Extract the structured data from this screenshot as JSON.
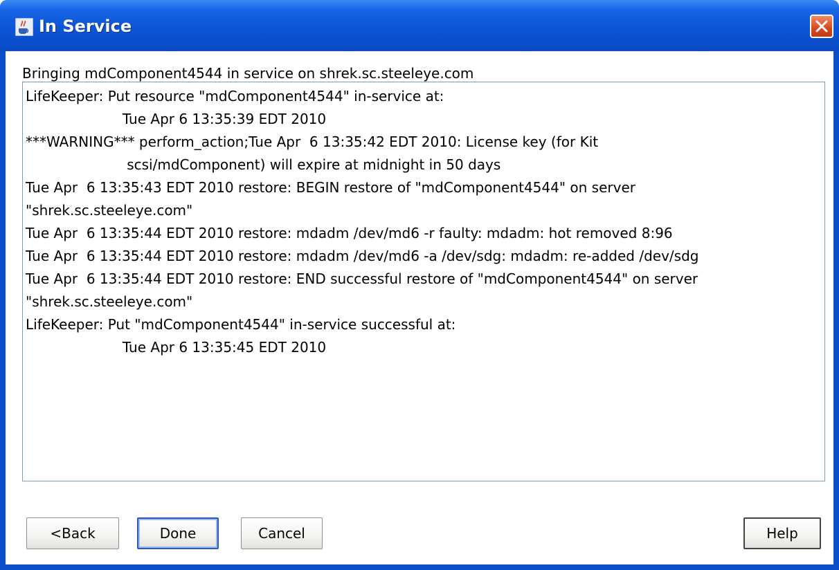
{
  "window": {
    "title": "In Service",
    "app_icon": "java-cup-icon",
    "close_icon": "close-icon"
  },
  "status": "Bringing mdComponent4544 in service on shrek.sc.steeleye.com",
  "log_lines": [
    "LifeKeeper: Put resource \"mdComponent4544\" in-service at:",
    "                      Tue Apr 6 13:35:39 EDT 2010",
    "***WARNING*** perform_action;Tue Apr  6 13:35:42 EDT 2010: License key (for Kit",
    "                       scsi/mdComponent) will expire at midnight in 50 days",
    "Tue Apr  6 13:35:43 EDT 2010 restore: BEGIN restore of \"mdComponent4544\" on server",
    "\"shrek.sc.steeleye.com\"",
    "Tue Apr  6 13:35:44 EDT 2010 restore: mdadm /dev/md6 -r faulty: mdadm: hot removed 8:96",
    "Tue Apr  6 13:35:44 EDT 2010 restore: mdadm /dev/md6 -a /dev/sdg: mdadm: re-added /dev/sdg",
    "Tue Apr  6 13:35:44 EDT 2010 restore: END successful restore of \"mdComponent4544\" on server",
    "\"shrek.sc.steeleye.com\"",
    "LifeKeeper: Put \"mdComponent4544\" in-service successful at:",
    "                      Tue Apr 6 13:35:45 EDT 2010"
  ],
  "buttons": {
    "back": "<Back",
    "done": "Done",
    "cancel": "Cancel",
    "help": "Help"
  },
  "colors": {
    "titlebar": "#0a55d6",
    "close_button": "#d8481e",
    "log_border": "#7f9db9"
  }
}
